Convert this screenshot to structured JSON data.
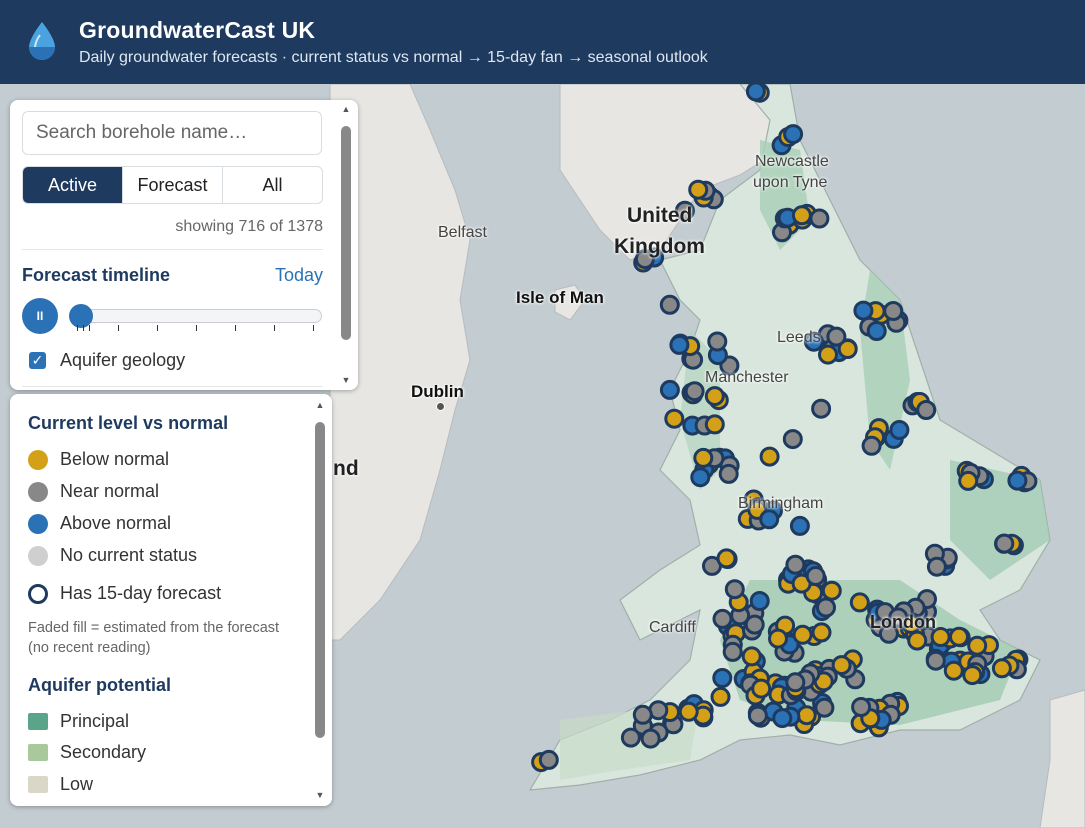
{
  "app": {
    "title": "GroundwaterCast UK",
    "subtitle": "Daily groundwater forecasts · current status vs normal → 15-day fan → seasonal outlook"
  },
  "colors": {
    "header": "#1e3a5f",
    "below": "#d4a017",
    "near": "#888888",
    "above": "#2a72b5",
    "none": "#cfcfcf",
    "principal": "#5aa58a",
    "secondary": "#a9c99c",
    "low": "#dbd7c8"
  },
  "controls": {
    "search_placeholder": "Search borehole name…",
    "filters": [
      "Active",
      "Forecast",
      "All"
    ],
    "active_filter": "Active",
    "showing": "showing 716 of 1378",
    "timeline_title": "Forecast timeline",
    "today_label": "Today",
    "play_label": "II",
    "timeline_position": 0,
    "aquifer_geology_label": "Aquifer geology",
    "aquifer_geology_checked": true
  },
  "legend": {
    "status_title": "Current level vs normal",
    "below": "Below normal",
    "near": "Near normal",
    "above": "Above normal",
    "none": "No current status",
    "forecast": "Has 15-day forecast",
    "note": "Faded fill = estimated from the forecast (no recent reading)",
    "aquifer_title": "Aquifer potential",
    "principal": "Principal",
    "secondary": "Secondary",
    "low": "Low"
  },
  "map_labels": {
    "belfast": "Belfast",
    "dublin": "Dublin",
    "isle_of_man": "Isle of Man",
    "uk_line1": "United",
    "uk_line2": "Kingdom",
    "newcastle_line1": "Newcastle",
    "newcastle_line2": "upon Tyne",
    "leeds": "Leeds",
    "manchester": "Manchester",
    "birmingham": "Birmingham",
    "cardiff": "Cardiff",
    "london": "London",
    "ireland_fragment": "nd"
  }
}
